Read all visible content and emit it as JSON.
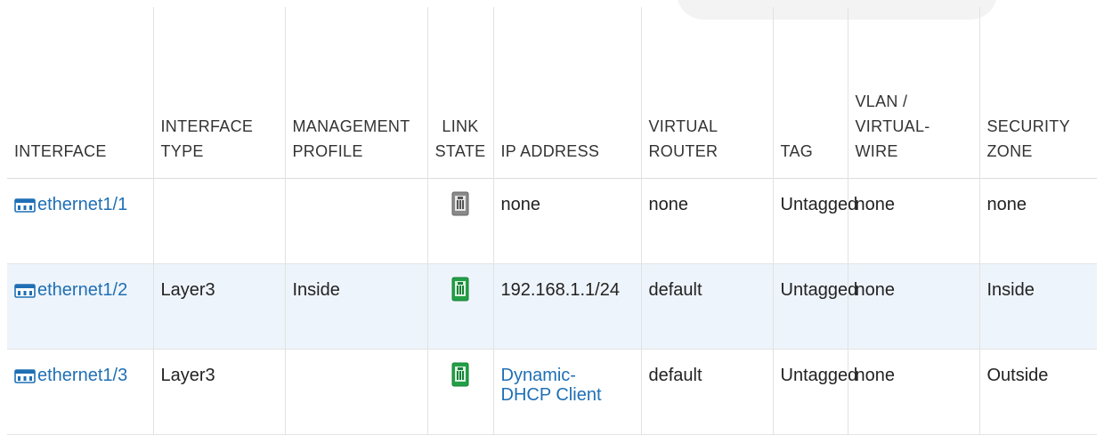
{
  "headers": {
    "interface": "INTERFACE",
    "interface_type": "INTERFACE TYPE",
    "management_profile": "MANAGEMENT PROFILE",
    "link_state": "LINK STATE",
    "ip_address": "IP ADDRESS",
    "virtual_router": "VIRTUAL ROUTER",
    "tag": "TAG",
    "vlan_virtual_wire": "VLAN / VIRTUAL-WIRE",
    "security_zone": "SECURITY ZONE"
  },
  "rows": [
    {
      "interface": "ethernet1/1",
      "interface_type": "",
      "management_profile": "",
      "link_state": "down",
      "ip_address": "none",
      "virtual_router": "none",
      "tag": "Untagged",
      "vlan_virtual_wire": "none",
      "security_zone": "none"
    },
    {
      "interface": "ethernet1/2",
      "interface_type": "Layer3",
      "management_profile": "Inside",
      "link_state": "up",
      "ip_address": "192.168.1.1/24",
      "virtual_router": "default",
      "tag": "Untagged",
      "vlan_virtual_wire": "none",
      "security_zone": "Inside"
    },
    {
      "interface": "ethernet1/3",
      "interface_type": "Layer3",
      "management_profile": "",
      "link_state": "up",
      "ip_address": "Dynamic-DHCP Client",
      "virtual_router": "default",
      "tag": "Untagged",
      "vlan_virtual_wire": "none",
      "security_zone": "Outside"
    }
  ],
  "icons": {
    "interface": "ethernet-port-icon",
    "link_state_up": "link-up-icon",
    "link_state_down": "link-down-icon"
  },
  "colors": {
    "link_blue": "#1f6fb5",
    "link_up_green": "#22a046",
    "link_down_gray": "#777777",
    "row_highlight": "#eef4fb"
  }
}
